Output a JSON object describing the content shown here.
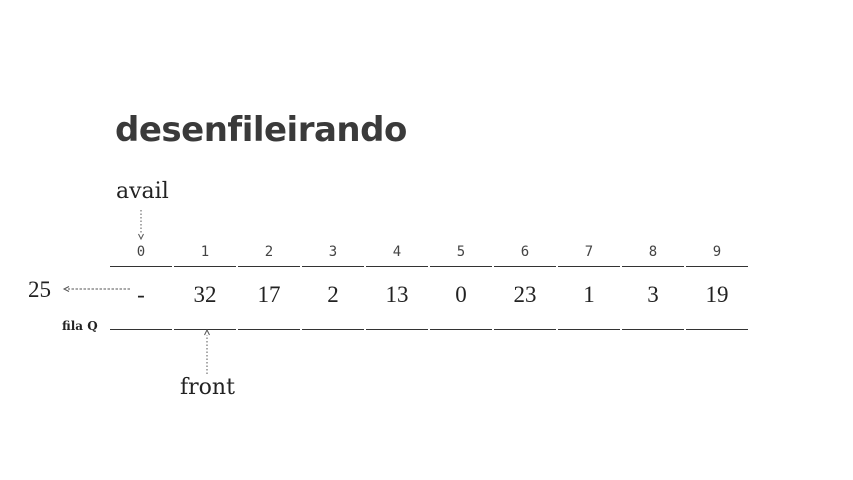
{
  "title": "desenfileirando",
  "avail_label": "avail",
  "front_label": "front",
  "removed_value": "25",
  "queue_name": "fila Q",
  "queue": {
    "indices": [
      "0",
      "1",
      "2",
      "3",
      "4",
      "5",
      "6",
      "7",
      "8",
      "9"
    ],
    "values": [
      "-",
      "32",
      "17",
      "2",
      "13",
      "0",
      "23",
      "1",
      "3",
      "19"
    ]
  }
}
